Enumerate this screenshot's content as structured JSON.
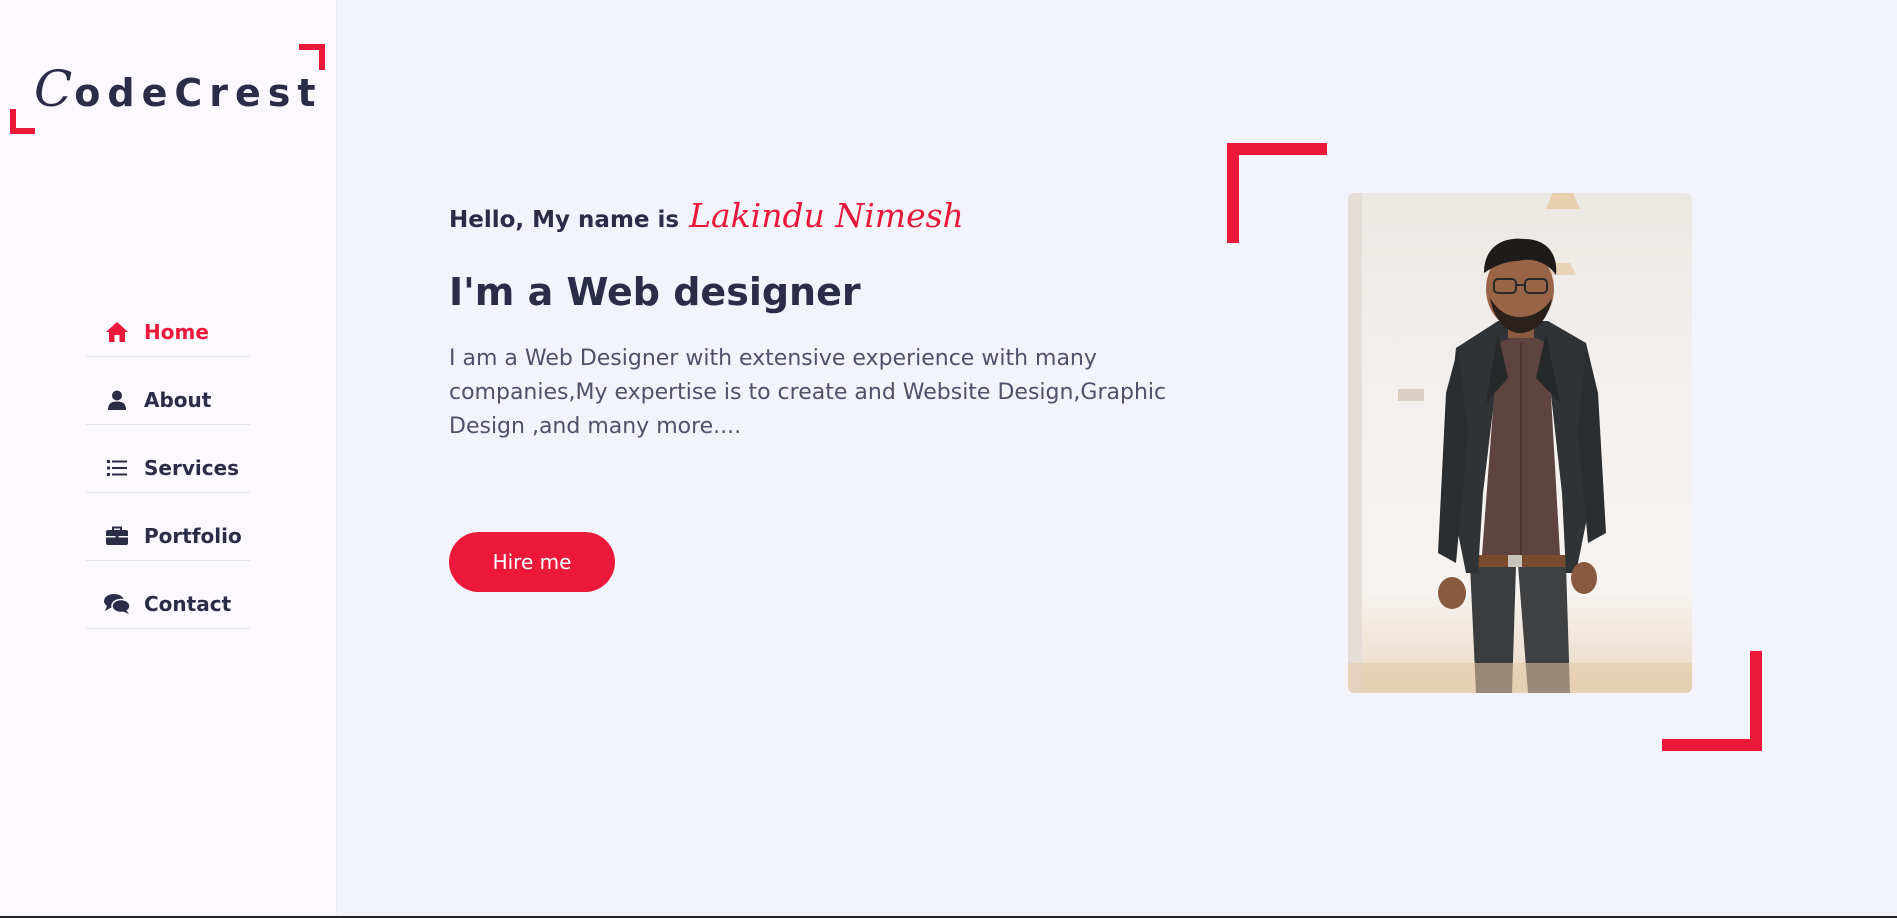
{
  "brand": {
    "logo_first": "C",
    "logo_rest": "odeCrest"
  },
  "nav": {
    "items": [
      {
        "label": "Home",
        "icon": "home-icon",
        "active": true
      },
      {
        "label": "About",
        "icon": "user-icon",
        "active": false
      },
      {
        "label": "Services",
        "icon": "list-icon",
        "active": false
      },
      {
        "label": "Portfolio",
        "icon": "briefcase-icon",
        "active": false
      },
      {
        "label": "Contact",
        "icon": "comments-icon",
        "active": false
      }
    ]
  },
  "hero": {
    "greeting": "Hello, My name is",
    "name": "Lakindu Nimesh",
    "headline": "I'm a Web designer",
    "description": "I am a Web Designer with extensive experience with many companies,My expertise is to create and Website Design,Graphic Design ,and many more....",
    "cta_label": "Hire me"
  },
  "colors": {
    "accent": "#ec1839",
    "text_dark": "#2b2c48",
    "sidebar_bg": "#fcf8ff",
    "main_bg": "#f2f3fb"
  }
}
